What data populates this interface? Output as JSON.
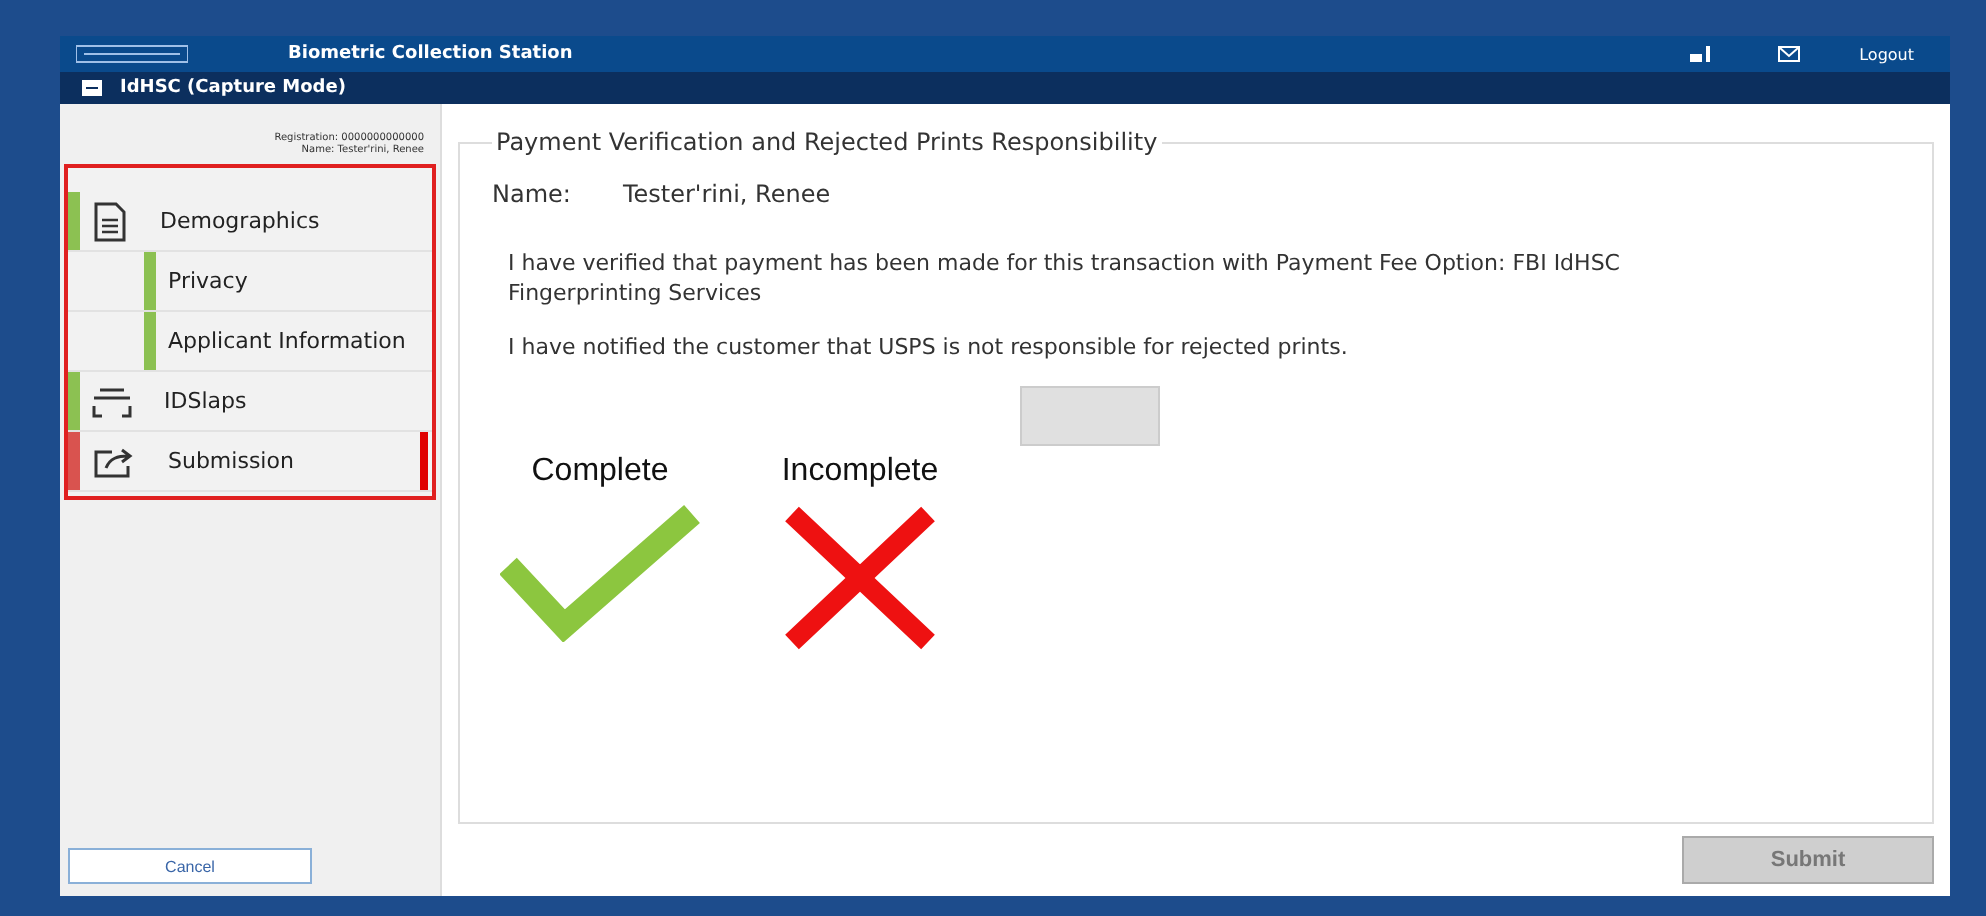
{
  "window": {
    "title": "Biometric Collection Station",
    "subtitle": "IdHSC (Capture Mode)",
    "logout": "Logout"
  },
  "applicant": {
    "registration": "Registration: 0000000000000",
    "name": "Name: Tester'rini, Renee"
  },
  "nav": [
    {
      "kind": "document",
      "label": "Demographics",
      "complete": true,
      "selected": false,
      "children": [
        {
          "label": "Privacy",
          "complete": true,
          "selected": false
        },
        {
          "label": "Applicant Information",
          "complete": true,
          "selected": false
        }
      ]
    },
    {
      "kind": "scanner",
      "label": "IDSlaps",
      "complete": true,
      "selected": false
    },
    {
      "kind": "export",
      "label": "Submission",
      "complete": false,
      "selected": true
    }
  ],
  "cancel": "Cancel",
  "panel": {
    "legend": "Payment Verification and Rejected Prints Responsibility",
    "name_label": "Name:",
    "name_value": "Tester'rini, Renee",
    "statements": [
      "I have verified that payment has been made for this transaction with Payment Fee Option: FBI IdHSC Fingerprinting Services",
      "I have notified the customer that USPS is not responsible for rejected prints."
    ],
    "confirm_disabled": true
  },
  "key": [
    {
      "kind": "complete",
      "label": "Complete"
    },
    {
      "kind": "incomplete",
      "label": "Incomplete"
    }
  ],
  "submit": {
    "label": "Submit",
    "disabled": true
  }
}
